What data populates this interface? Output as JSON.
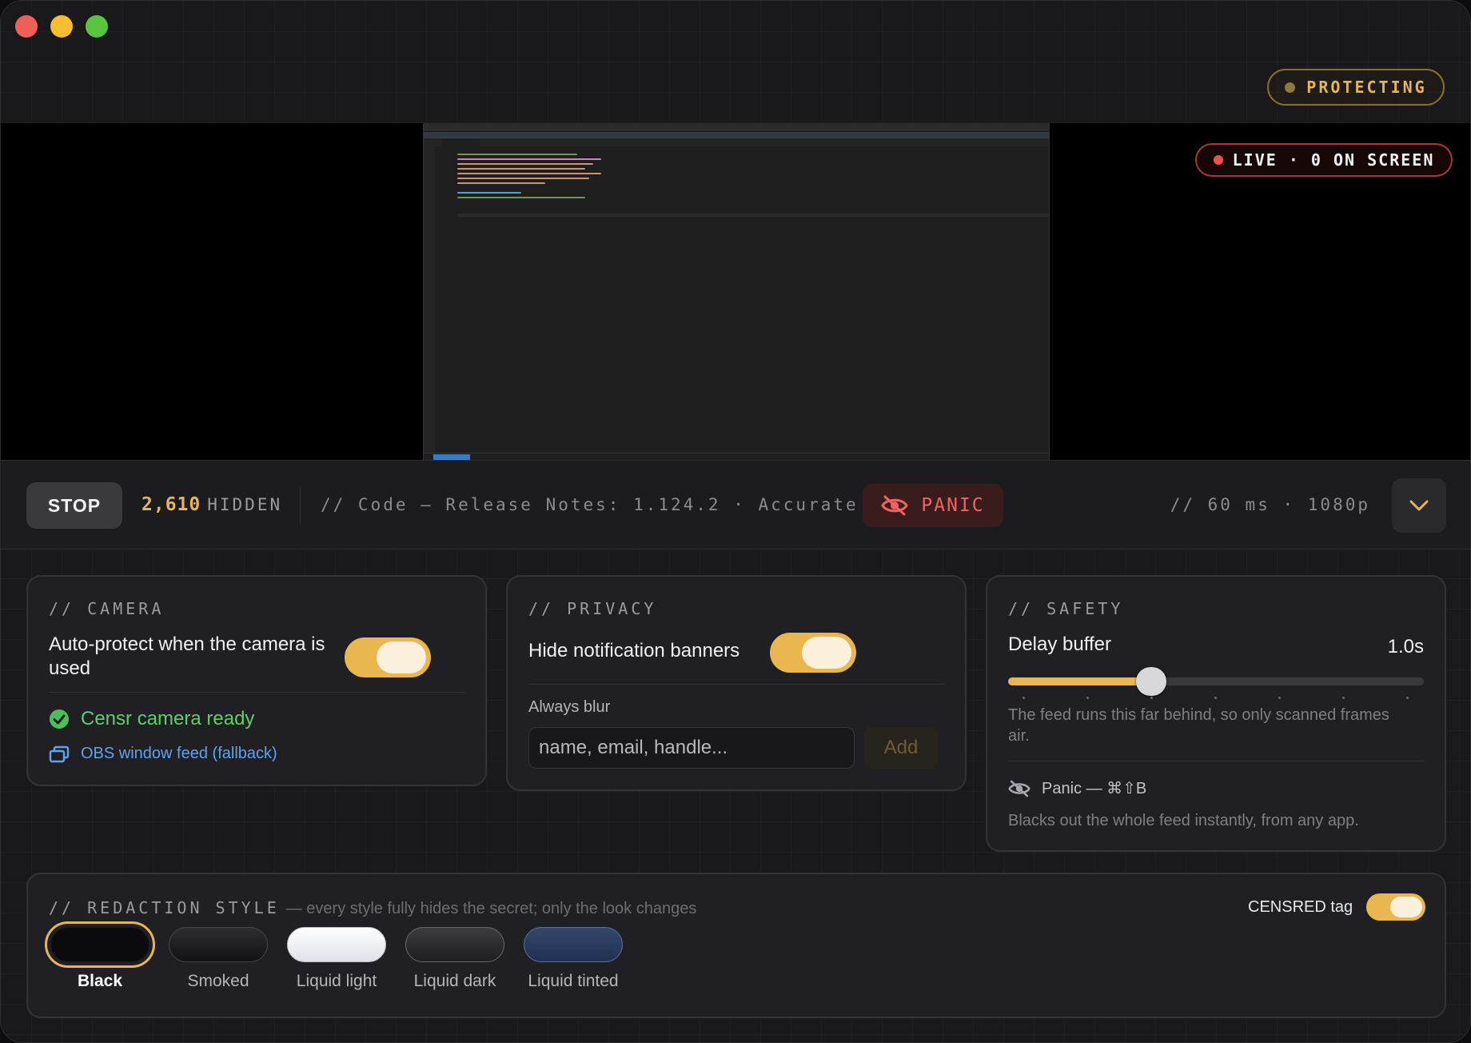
{
  "window": {
    "controls": [
      "close",
      "minimize",
      "zoom"
    ]
  },
  "header": {
    "status_badge": "PROTECTING"
  },
  "preview": {
    "live_badge": "LIVE · 0 ON SCREEN",
    "captured_app": "code-editor"
  },
  "control_bar": {
    "stop_label": "STOP",
    "hidden_count": "2,610",
    "hidden_label": "HIDDEN",
    "context": "// Code — Release Notes: 1.124.2 · Accurate",
    "panic_label": "PANIC",
    "stats": "// 60 ms · 1080p"
  },
  "camera": {
    "title": "// CAMERA",
    "auto_protect_label": "Auto-protect when the camera is used",
    "auto_protect_on": true,
    "status": "Censr camera ready",
    "obs_link": "OBS window feed (fallback)"
  },
  "privacy": {
    "title": "// PRIVACY",
    "hide_banners_label": "Hide notification banners",
    "hide_banners_on": true,
    "always_blur_label": "Always blur",
    "input_placeholder": "name, email, handle...",
    "add_label": "Add"
  },
  "safety": {
    "title": "// SAFETY",
    "delay_label": "Delay buffer",
    "delay_value": "1.0s",
    "delay_fraction": 0.345,
    "delay_help": "The feed runs this far behind, so only scanned frames air.",
    "panic_shortcut": "Panic — ⌘⇧B",
    "panic_help": "Blacks out the whole feed instantly, from any app."
  },
  "redaction": {
    "title": "// REDACTION STYLE",
    "subtitle": "— every style fully hides the secret; only the look changes",
    "tag_label": "CENSRED tag",
    "tag_on": true,
    "styles": [
      {
        "label": "Black",
        "selected": true
      },
      {
        "label": "Smoked",
        "selected": false
      },
      {
        "label": "Liquid light",
        "selected": false
      },
      {
        "label": "Liquid dark",
        "selected": false
      },
      {
        "label": "Liquid tinted",
        "selected": false
      }
    ]
  },
  "colors": {
    "accent": "#e9b650",
    "danger": "#ef6363",
    "success": "#5fcf6a",
    "link": "#5ea2f0",
    "background": "#19191c"
  },
  "icons": [
    "eye-slash-icon",
    "check-circle-icon",
    "window-stack-icon",
    "chevron-down-icon"
  ]
}
